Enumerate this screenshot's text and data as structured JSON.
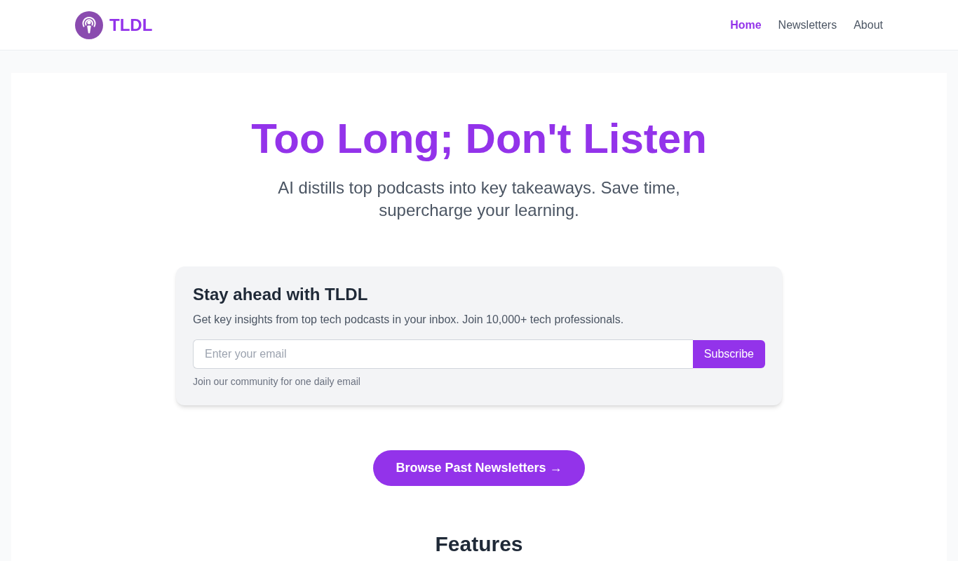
{
  "header": {
    "logo_text": "TLDL",
    "nav": [
      {
        "label": "Home",
        "selected": true
      },
      {
        "label": "Newsletters",
        "selected": false
      },
      {
        "label": "About",
        "selected": false
      }
    ]
  },
  "hero": {
    "title": "Too Long; Don't Listen",
    "subtitle": "AI distills top podcasts into key takeaways. Save time, supercharge your learning."
  },
  "signup_card": {
    "title": "Stay ahead with TLDL",
    "description": "Get key insights from top tech podcasts in your inbox. Join 10,000+ tech professionals.",
    "email_field": {
      "placeholder": "Enter your email"
    },
    "submit_button": "Subscribe",
    "note": "Join our community for one daily email"
  },
  "browse_button": "Browse Past Newsletters →",
  "features": {
    "title": "Features"
  }
}
